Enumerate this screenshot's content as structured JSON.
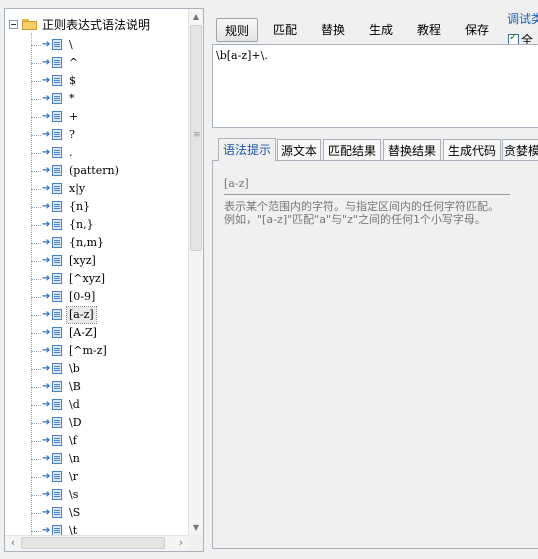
{
  "tree": {
    "root_label": "正则表达式语法说明",
    "items": [
      "\\",
      "^",
      "$",
      "*",
      "+",
      "?",
      ".",
      "(pattern)",
      "x|y",
      "{n}",
      "{n,}",
      "{n,m}",
      "[xyz]",
      "[^xyz]",
      "[0-9]",
      "[a-z]",
      "[A-Z]",
      "[^m-z]",
      "\\b",
      "\\B",
      "\\d",
      "\\D",
      "\\f",
      "\\n",
      "\\r",
      "\\s",
      "\\S",
      "\\t"
    ],
    "selected_index": 15
  },
  "toolbar": {
    "rule": "规则",
    "match": "匹配",
    "replace": "替换",
    "generate": "生成",
    "tutorial": "教程",
    "save": "保存",
    "debug_label": "调试类",
    "full_checkbox": "全",
    "full_checked": true
  },
  "regex": {
    "value": "\\b[a-z]+\\."
  },
  "tabs": [
    "语法提示",
    "源文本",
    "匹配结果",
    "替换结果",
    "生成代码",
    "贪婪模"
  ],
  "hint": {
    "title": "[a-z]",
    "line1": "表示某个范围内的字符。与指定区间内的任何字符匹配。",
    "line2": "例如，\"[a-z]\"匹配\"a\"与\"z\"之间的任何1个小写字母。"
  }
}
